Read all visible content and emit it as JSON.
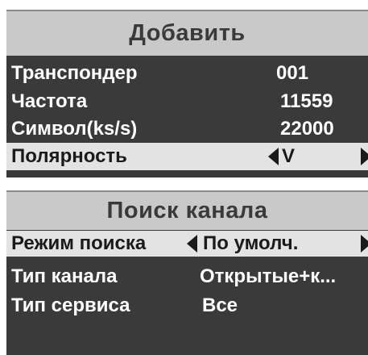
{
  "add_panel": {
    "title": "Добавить",
    "rows": [
      {
        "label": "Транспондер",
        "value": "001"
      },
      {
        "label": "Частота",
        "value": "11559"
      },
      {
        "label": "Символ(ks/s)",
        "value": "22000"
      },
      {
        "label": "Полярность",
        "value": "V",
        "selected": true
      }
    ]
  },
  "search_panel": {
    "title": "Поиск канала",
    "rows": [
      {
        "label": "Режим поиска",
        "value": "По умолч.",
        "selected": true
      },
      {
        "label": "Тип канала",
        "value": "Открытые+к..."
      },
      {
        "label": "Тип сервиса",
        "value": "Все"
      }
    ]
  },
  "icons": {
    "left": "triangle-left-icon",
    "right": "triangle-right-icon"
  },
  "colors": {
    "panel_bg": "#3a3a3a",
    "title_bg": "#c9c9c9",
    "selected_bg": "#e3e3e3",
    "text": "#ffffff"
  }
}
